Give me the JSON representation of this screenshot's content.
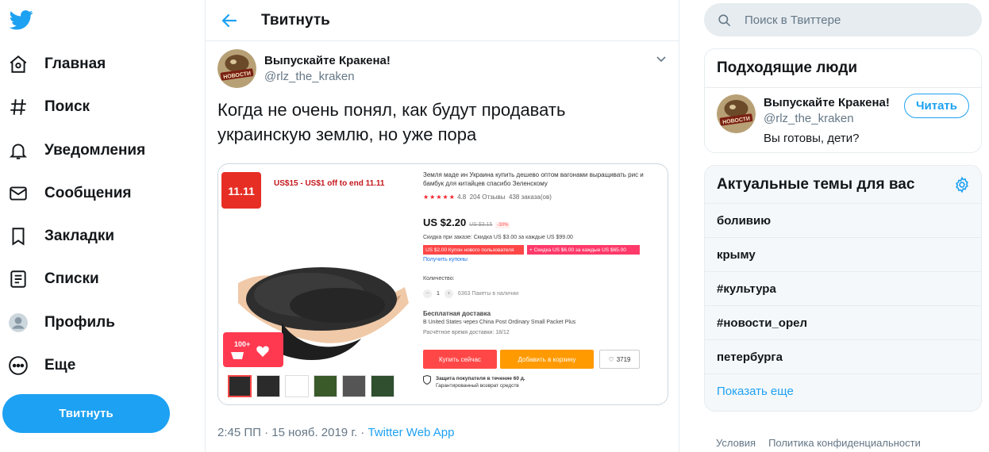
{
  "nav": {
    "items": [
      {
        "label": "Главная",
        "icon": "home-icon"
      },
      {
        "label": "Поиск",
        "icon": "hashtag-icon"
      },
      {
        "label": "Уведомления",
        "icon": "bell-icon"
      },
      {
        "label": "Сообщения",
        "icon": "mail-icon"
      },
      {
        "label": "Закладки",
        "icon": "bookmark-icon"
      },
      {
        "label": "Списки",
        "icon": "list-icon"
      },
      {
        "label": "Профиль",
        "icon": "profile-icon"
      },
      {
        "label": "Еще",
        "icon": "more-icon"
      }
    ],
    "tweet_button": "Твитнуть"
  },
  "header": {
    "title": "Твитнуть"
  },
  "tweet": {
    "author_name": "Выпускайте Кракена!",
    "author_handle": "@rlz_the_kraken",
    "avatar_text": "НОВОСТИ",
    "text": "Когда не очень понял, как будут продавать украинскую землю, но уже пора",
    "time_date": "2:45 ПП · 15 нояб. 2019 г. · ",
    "source": "Twitter Web App"
  },
  "media": {
    "badge": "11.11",
    "promo": "US$15 - US$1 off to end 11.11",
    "sticker": "100+",
    "title": "Земля маде ин Украина купить дешево оптом вагонами выращивать рис и бамбук для китайцев спасибо Зеленскому",
    "rating": "4.8",
    "reviews": "204 Отзывы",
    "orders": "438 заказа(ов)",
    "price": "US $2.20",
    "old_price": "US $3.15",
    "discount": "-30%",
    "order_discount": "Скидка при заказе: Скидка US $3.00 за каждые US $99.00",
    "coupon1": "US $2.00 Купон нового пользователя",
    "coupon2": "+ Скидка US $6.00 за каждые US $65.00",
    "get_coupons": "Получить купоны",
    "qty_label": "Количество:",
    "qty_value": "1",
    "stock": "6363 Пакеты в наличии",
    "shipping_title": "Бесплатная доставка",
    "shipping_detail": "В United States через China Post Ordinary Small Packet Plus",
    "delivery": "Расчётное время доставки: 18/12",
    "buy_now": "Купить сейчас",
    "add_to_cart": "Добавить в корзину",
    "wishlist_count": "3719",
    "protection_title": "Защита покупателя в течение 60 д.",
    "protection_sub": "Гарантированный возврат средств"
  },
  "search": {
    "placeholder": "Поиск в Твиттере"
  },
  "people": {
    "title": "Подходящие люди",
    "name": "Выпускайте Кракена!",
    "handle": "@rlz_the_kraken",
    "bio": "Вы готовы, дети?",
    "follow_label": "Читать"
  },
  "trends": {
    "title": "Актуальные темы для вас",
    "items": [
      "боливию",
      "крыму",
      "#культура",
      "#новости_орел",
      "петербурга"
    ],
    "show_more": "Показать еще"
  },
  "footer": {
    "links": [
      "Условия",
      "Политика конфиденциальности"
    ]
  },
  "colors": {
    "accent": "#1da1f2",
    "buy": "#ff4747",
    "cart": "#ff9a00"
  }
}
